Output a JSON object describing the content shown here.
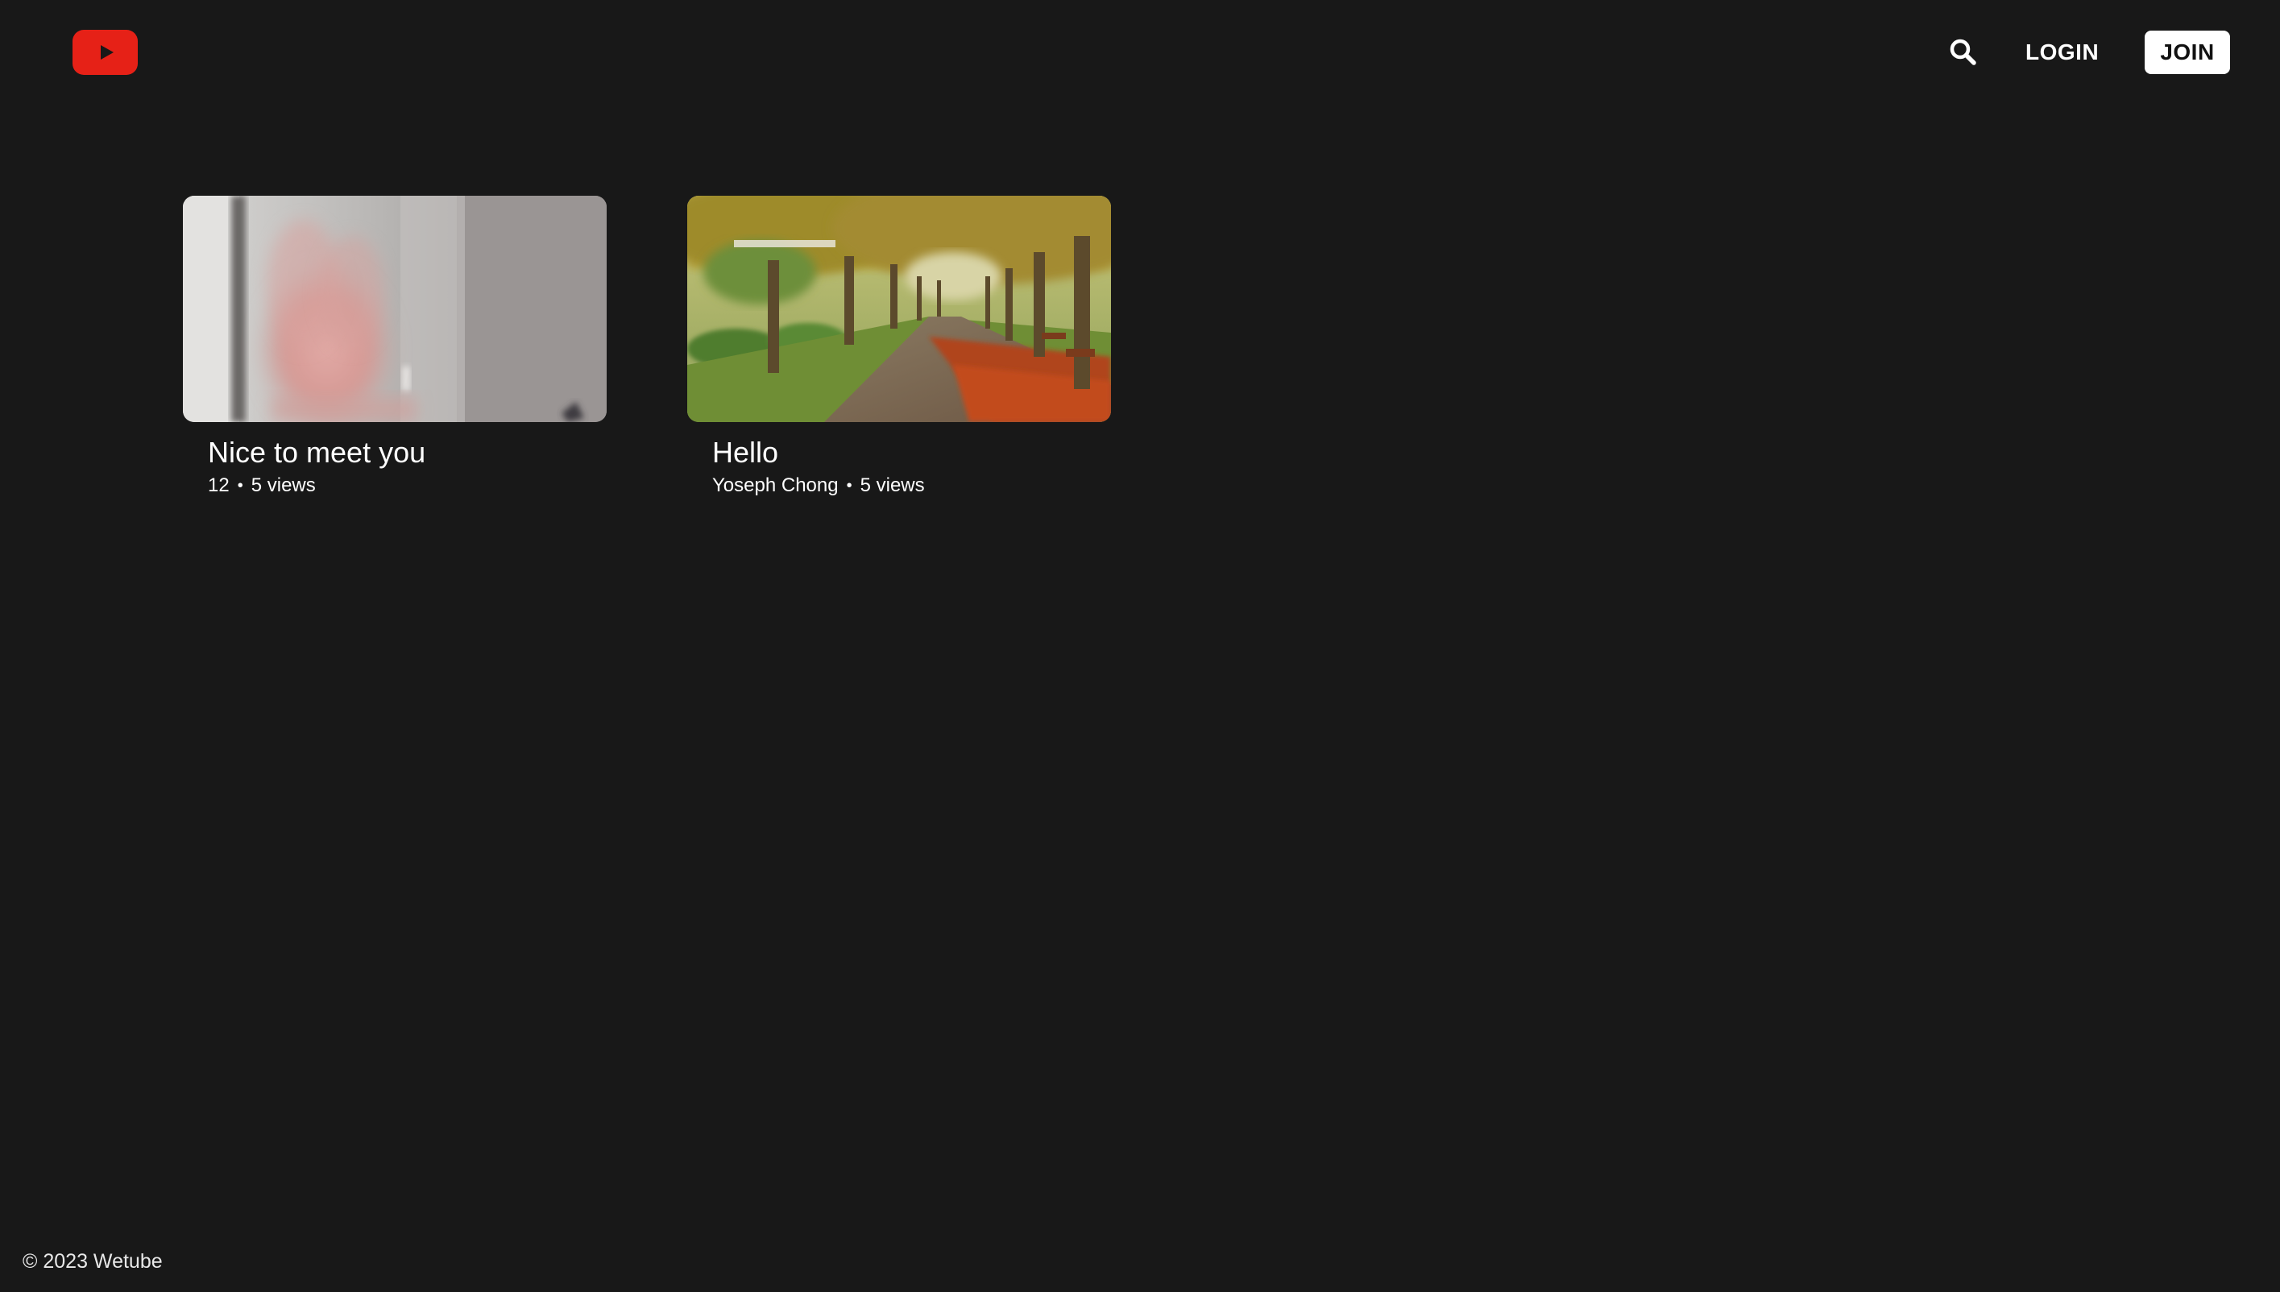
{
  "header": {
    "logo_icon": "youtube-play-icon",
    "search_icon": "search-icon",
    "login_label": "LOGIN",
    "join_label": "JOIN"
  },
  "videos": [
    {
      "title": "Nice to meet you",
      "owner": "12",
      "views": "5 views",
      "thumbnail": "blurred waving hand in a room"
    },
    {
      "title": "Hello",
      "owner": "Yoseph Chong",
      "views": "5 views",
      "thumbnail": "tree-lined park path with autumn leaves"
    }
  ],
  "footer": {
    "copyright": "© 2023 Wetube"
  },
  "colors": {
    "background": "#181818",
    "brand_red": "#e62117",
    "text": "#ffffff"
  }
}
